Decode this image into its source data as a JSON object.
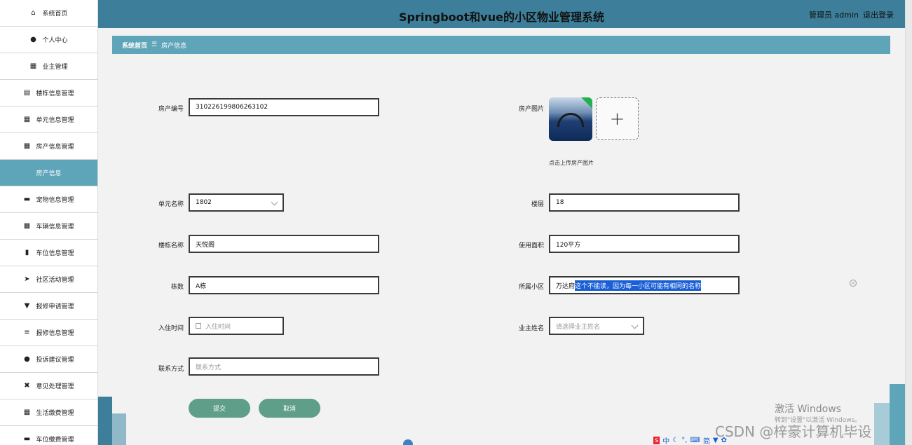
{
  "header": {
    "title": "Springboot和vue的小区物业管理系统",
    "user_label": "管理员 admin",
    "logout": "退出登录"
  },
  "sidebar": {
    "items": [
      {
        "label": "系统首页",
        "icon": "home-icon",
        "glyph": "⌂"
      },
      {
        "label": "个人中心",
        "icon": "user-icon",
        "glyph": "●"
      },
      {
        "label": "业主管理",
        "icon": "grid-icon",
        "glyph": "▦"
      },
      {
        "label": "楼栋信息管理",
        "icon": "clipboard-icon",
        "glyph": "▤"
      },
      {
        "label": "单元信息管理",
        "icon": "grid-icon",
        "glyph": "▦"
      },
      {
        "label": "房产信息管理",
        "icon": "grid-small-icon",
        "glyph": "▦"
      },
      {
        "label": "房产信息",
        "icon": "",
        "glyph": "",
        "active": true
      },
      {
        "label": "宠物信息管理",
        "icon": "chat-icon",
        "glyph": "▬"
      },
      {
        "label": "车辆信息管理",
        "icon": "grid-icon",
        "glyph": "▦"
      },
      {
        "label": "车位信息管理",
        "icon": "bar-chart-icon",
        "glyph": "▮"
      },
      {
        "label": "社区活动管理",
        "icon": "send-icon",
        "glyph": "➤"
      },
      {
        "label": "报修申请管理",
        "icon": "pin-icon",
        "glyph": "▼"
      },
      {
        "label": "报修信息管理",
        "icon": "list-icon",
        "glyph": "≡"
      },
      {
        "label": "投诉建议管理",
        "icon": "user-icon",
        "glyph": "●"
      },
      {
        "label": "意见处理管理",
        "icon": "ticket-icon",
        "glyph": "✖"
      },
      {
        "label": "生活缴费管理",
        "icon": "grid-icon",
        "glyph": "▦"
      },
      {
        "label": "车位缴费管理",
        "icon": "briefcase-icon",
        "glyph": "▬"
      }
    ]
  },
  "breadcrumb": {
    "home": "系统首页",
    "separator": "☰",
    "current": "房产信息"
  },
  "form": {
    "house_no_label": "房产编号",
    "house_no_value": "310226199806263102",
    "house_img_label": "房产图片",
    "upload_hint": "点击上传房产图片",
    "upload_plus": "+",
    "unit_label": "单元名称",
    "unit_value": "1802",
    "floor_label": "楼层",
    "floor_value": "18",
    "building_name_label": "楼栋名称",
    "building_name_value": "天悦阁",
    "area_label": "使用面积",
    "area_value": "120平方",
    "building_no_label": "栋数",
    "building_no_value": "A栋",
    "community_label": "所属小区",
    "community_value": "万达府",
    "community_selected_note": "这个不能读，因为每一小区可能有相同的名称",
    "checkin_label": "入住时间",
    "checkin_placeholder": "入住时间",
    "owner_label": "业主姓名",
    "owner_placeholder": "请选择业主姓名",
    "contact_label": "联系方式",
    "contact_placeholder": "联系方式"
  },
  "buttons": {
    "submit": "提交",
    "cancel": "取消"
  },
  "overlay": {
    "activate_title": "激活 Windows",
    "activate_sub": "转到\"设置\"以激活 Windows。",
    "csdn": "CSDN @梓豪计算机毕设",
    "ime": [
      "中",
      "简"
    ]
  }
}
